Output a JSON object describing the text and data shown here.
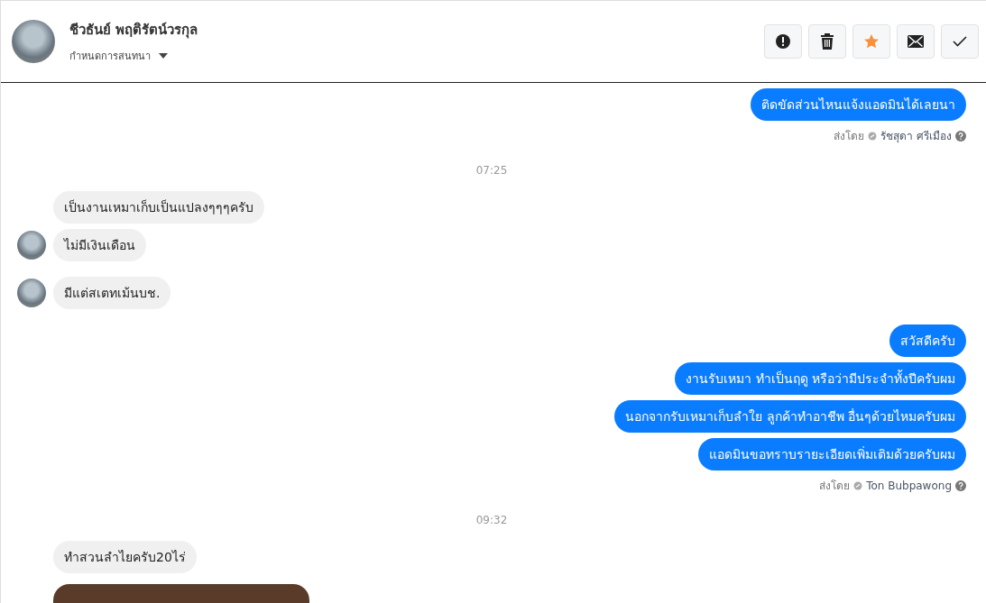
{
  "header": {
    "name": "ชีวธันย์ พฤติรัตน์วรกุล",
    "subtitle": "กำหนดการสนทนา",
    "actions": [
      {
        "kind": "spam",
        "on": false
      },
      {
        "kind": "delete",
        "on": false
      },
      {
        "kind": "star",
        "on": true
      },
      {
        "kind": "unread",
        "on": false
      },
      {
        "kind": "done",
        "on": false
      }
    ]
  },
  "messages": [
    {
      "kind": "outgoing",
      "text": "ติดขัดส่วนไหนแจ้งแอดมินได้เลยนา"
    },
    {
      "kind": "sent_by",
      "label": "ส่งโดย",
      "name": "รัชสุดา ศรีเมือง"
    },
    {
      "kind": "time",
      "text": "07:25"
    },
    {
      "kind": "incoming",
      "text": "เป็นงานเหมาเก็บเป็นแปลงๆๆๆครับ",
      "avatar": false
    },
    {
      "kind": "incoming",
      "text": "ไม่มีเงินเดือน",
      "avatar": true
    },
    {
      "kind": "incoming",
      "text": "มีแต่สเตทเม้นบช.",
      "avatar": true
    },
    {
      "kind": "outgoing",
      "text": "สวัสดีครับ"
    },
    {
      "kind": "outgoing",
      "text": "งานรับเหมา ทำเป็นฤดู หรือว่ามีประจำทั้งปีครับผม"
    },
    {
      "kind": "outgoing",
      "text": "นอกจากรับเหมาเก็บลำใย ลูกค้าทำอาชีพ อื่นๆด้วยไหมครับผม"
    },
    {
      "kind": "outgoing",
      "text": "แอดมินขอทราบรายะเอียดเพิ่มเติมด้วยครับผม"
    },
    {
      "kind": "sent_by",
      "label": "ส่งโดย",
      "name": "Ton Bubpawong"
    },
    {
      "kind": "time",
      "text": "09:32"
    },
    {
      "kind": "incoming",
      "text": "ทำสวนลำไยครับ20ไร่",
      "avatar": false
    },
    {
      "kind": "image"
    }
  ]
}
